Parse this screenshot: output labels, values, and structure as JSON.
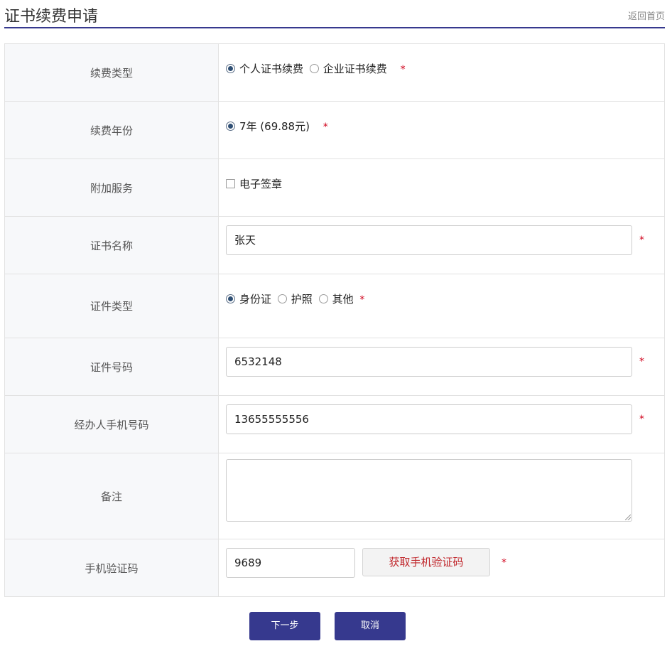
{
  "header": {
    "title": "证书续费申请",
    "home_link": "返回首页"
  },
  "form": {
    "renew_type": {
      "label": "续费类型",
      "options": [
        "个人证书续费",
        "企业证书续费"
      ],
      "selected": "个人证书续费",
      "required": "*"
    },
    "renew_years": {
      "label": "续费年份",
      "options": [
        "7年 (69.88元)"
      ],
      "selected": "7年 (69.88元)",
      "required": "*"
    },
    "extra_service": {
      "label": "附加服务",
      "options": [
        "电子签章"
      ],
      "checked": false
    },
    "cert_name": {
      "label": "证书名称",
      "value": "张天",
      "required": "*"
    },
    "id_type": {
      "label": "证件类型",
      "options": [
        "身份证",
        "护照",
        "其他"
      ],
      "selected": "身份证",
      "required": "*"
    },
    "id_number": {
      "label": "证件号码",
      "value": "6532148",
      "required": "*"
    },
    "phone": {
      "label": "经办人手机号码",
      "value": "13655555556",
      "required": "*"
    },
    "remark": {
      "label": "备注",
      "value": ""
    },
    "sms_code": {
      "label": "手机验证码",
      "value": "9689",
      "get_code_label": "获取手机验证码",
      "required": "*"
    }
  },
  "actions": {
    "next_label": "下一步",
    "cancel_label": "取消"
  },
  "colors": {
    "primary": "#36398e",
    "required": "#d0021b",
    "label_bg": "#f7f8fa"
  }
}
